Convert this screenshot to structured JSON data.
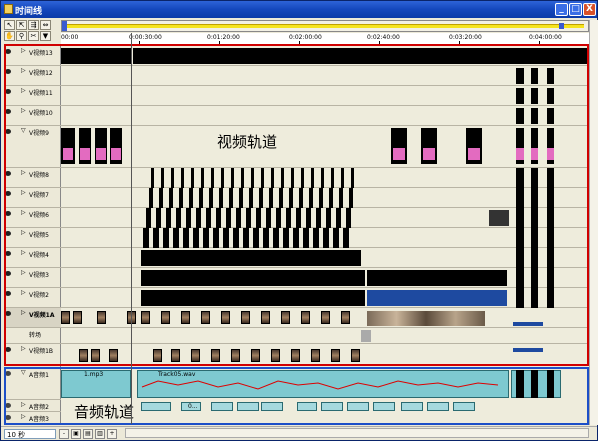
{
  "window": {
    "title": "时间线",
    "minimize": "_",
    "maximize": "□",
    "close": "X"
  },
  "ruler": {
    "ticks": [
      "00:00",
      "0:00:30:00",
      "0:01:20:00",
      "0:02:00:00",
      "0:02:40:00",
      "0:03:20:00",
      "0:04:00:00"
    ]
  },
  "tracks": {
    "video": [
      {
        "label": "V视频13"
      },
      {
        "label": "V视频12"
      },
      {
        "label": "V视频11"
      },
      {
        "label": "V视频10"
      },
      {
        "label": "V视频9"
      },
      {
        "label": "V视频8"
      },
      {
        "label": "V视频7"
      },
      {
        "label": "V视频6"
      },
      {
        "label": "V视频5"
      },
      {
        "label": "V视频4"
      },
      {
        "label": "V视频3"
      },
      {
        "label": "V视频2"
      },
      {
        "label": "V视频1A"
      },
      {
        "label": "转场"
      },
      {
        "label": "V视频1B"
      }
    ],
    "audio": [
      {
        "label": "A音频1"
      },
      {
        "label": "A音频2"
      },
      {
        "label": "A音频3"
      }
    ]
  },
  "annotations": {
    "video_label": "视频轨道",
    "audio_label": "音频轨道"
  },
  "audio_clips": {
    "clip1": "1.mp3",
    "clip2": "Track05.wav",
    "clip3": "0..."
  },
  "status": {
    "zoom": "10 秒"
  }
}
